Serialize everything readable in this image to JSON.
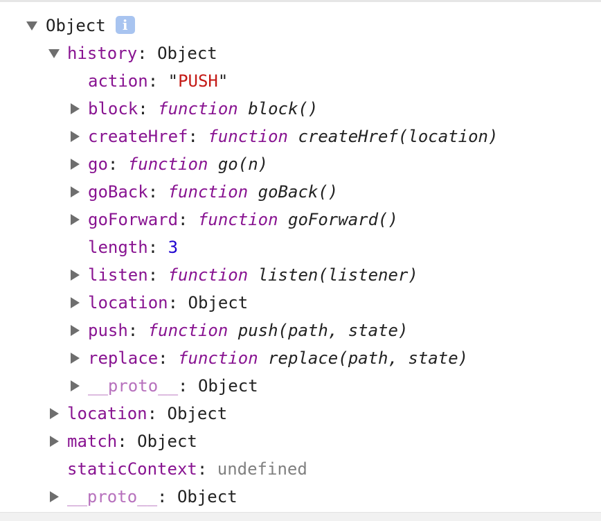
{
  "root": {
    "label": "Object",
    "info_icon": "i"
  },
  "tree": {
    "history": {
      "key": "history",
      "value": "Object",
      "children": {
        "action": {
          "key": "action",
          "quote_open": "\"",
          "value": "PUSH",
          "quote_close": "\""
        },
        "block": {
          "key": "block",
          "kw": "function",
          "sig": "block()"
        },
        "createHref": {
          "key": "createHref",
          "kw": "function",
          "sig": "createHref(location)"
        },
        "go": {
          "key": "go",
          "kw": "function",
          "sig": "go(n)"
        },
        "goBack": {
          "key": "goBack",
          "kw": "function",
          "sig": "goBack()"
        },
        "goForward": {
          "key": "goForward",
          "kw": "function",
          "sig": "goForward()"
        },
        "length": {
          "key": "length",
          "value": "3"
        },
        "listen": {
          "key": "listen",
          "kw": "function",
          "sig": "listen(listener)"
        },
        "location": {
          "key": "location",
          "value": "Object"
        },
        "push": {
          "key": "push",
          "kw": "function",
          "sig": "push(path, state)"
        },
        "replace": {
          "key": "replace",
          "kw": "function",
          "sig": "replace(path, state)"
        },
        "proto": {
          "key": "__proto__",
          "value": "Object"
        }
      }
    },
    "location": {
      "key": "location",
      "value": "Object"
    },
    "match": {
      "key": "match",
      "value": "Object"
    },
    "staticContext": {
      "key": "staticContext",
      "value": "undefined"
    },
    "proto": {
      "key": "__proto__",
      "value": "Object"
    }
  },
  "sep": ":",
  "colors": {
    "key": "#881391",
    "proto_key": "#b771bd",
    "string": "#c41a16",
    "number": "#1c00cf",
    "undefined": "#808080",
    "info_badge": "#a8c4f0"
  }
}
